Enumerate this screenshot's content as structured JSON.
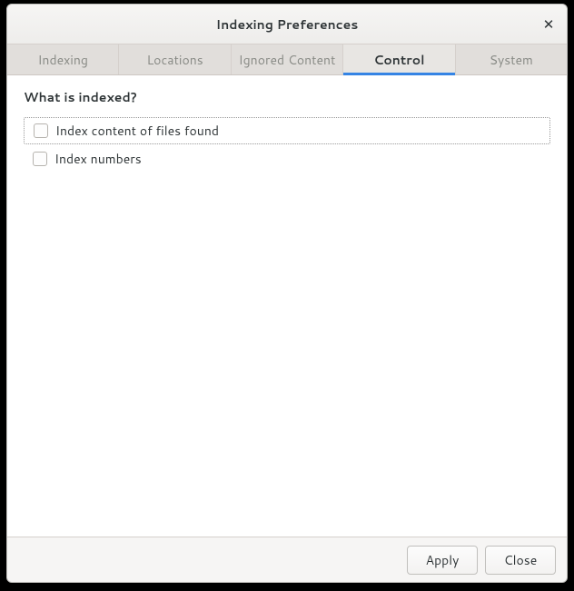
{
  "window": {
    "title": "Indexing Preferences"
  },
  "tabs": [
    {
      "label": "Indexing",
      "active": false
    },
    {
      "label": "Locations",
      "active": false
    },
    {
      "label": "Ignored Content",
      "active": false
    },
    {
      "label": "Control",
      "active": true
    },
    {
      "label": "System",
      "active": false
    }
  ],
  "content": {
    "section_title": "What is indexed?",
    "options": [
      {
        "label": "Index content of files found",
        "checked": false,
        "focused": true
      },
      {
        "label": "Index numbers",
        "checked": false,
        "focused": false
      }
    ]
  },
  "actions": {
    "apply": "Apply",
    "close": "Close"
  }
}
